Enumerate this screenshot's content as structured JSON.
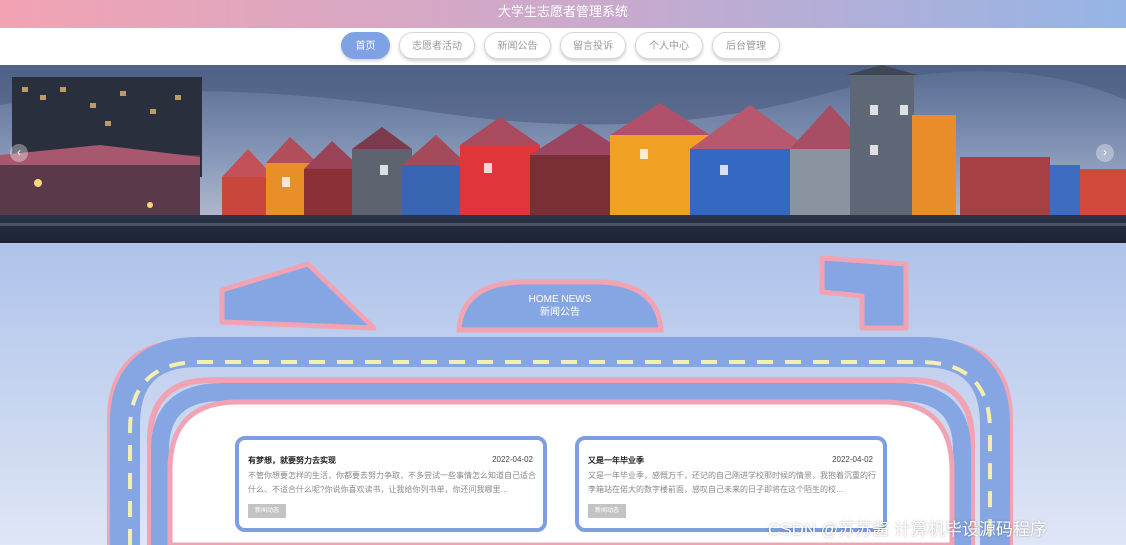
{
  "header": {
    "title": "大学生志愿者管理系统"
  },
  "nav": [
    {
      "label": "首页",
      "active": true
    },
    {
      "label": "志愿者活动"
    },
    {
      "label": "新闻公告"
    },
    {
      "label": "留言投诉"
    },
    {
      "label": "个人中心"
    },
    {
      "label": "后台管理"
    }
  ],
  "banner": {
    "prev_icon": "chevron-left-icon",
    "next_icon": "chevron-right-icon"
  },
  "news": {
    "title_en": "HOME NEWS",
    "title_cn": "新闻公告",
    "items": [
      {
        "title": "有梦想，就要努力去实现",
        "date": "2022-04-02",
        "desc": "不管你想要怎样的生活，你都要去努力争取，不多尝试一些事情怎么知道自己适合什么、不适合什么呢?你说你喜欢读书，让我给你列书单，你还问我哪里…",
        "button": "新闻动态"
      },
      {
        "title": "又是一年毕业季",
        "date": "2022-04-02",
        "desc": "又是一年毕业季，感慨万千，还记的自己刚进学校那时候的情景，我抱着沉重的行李箱站在偌大的数字楼前面，感叹自己未来的日子即将在这个陌生的校…",
        "button": "新闻动态"
      }
    ]
  },
  "watermark": "CSDN @苏苏酱   计算机毕设源码程序",
  "colors": {
    "accent": "#7fa2e5",
    "pink": "#f2a3b3",
    "road_dash": "#f4eeb0"
  }
}
